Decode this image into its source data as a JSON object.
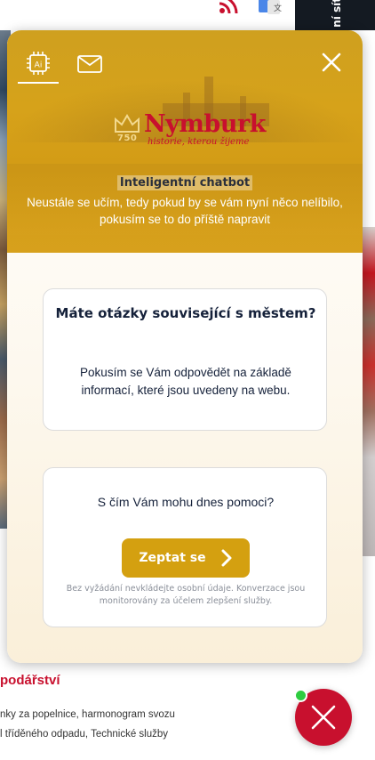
{
  "page": {
    "heading": "podářství",
    "line1": "nky za popelnice, harmonogram svozu",
    "line2": "l tříděného odpadu, Technické služby",
    "strip_text": "ní sít"
  },
  "chatbot": {
    "tabs": [
      {
        "label": "",
        "icon": "ai-chip-icon"
      },
      {
        "label": "",
        "icon": "mail-icon"
      }
    ],
    "logo": {
      "name": "Nymburk",
      "tagline": "historie, kterou žijeme",
      "number": "750"
    },
    "title": "Inteligentní chatbot",
    "subtitle": "Neustále se učím, tedy pokud by se vám nyní něco nelíbilo, pokusím se to do příště napravit",
    "info_card": {
      "title": "Máte otázky související s městem?",
      "text": "Pokusím se Vám odpovědět na základě informací, které jsou uvedeny na webu."
    },
    "ask_card": {
      "question": "S čím Vám mohu dnes pomoci?",
      "button_label": "Zeptat se",
      "note": "Bez vyžádání nevkládejte osobní údaje. Konverzace jsou monitorovány za účelem zlepšení služby."
    }
  },
  "colors": {
    "accent": "#d4a010",
    "brand_red": "#c8102e",
    "text_dark": "#15213a",
    "status_online": "#2ecc40"
  }
}
